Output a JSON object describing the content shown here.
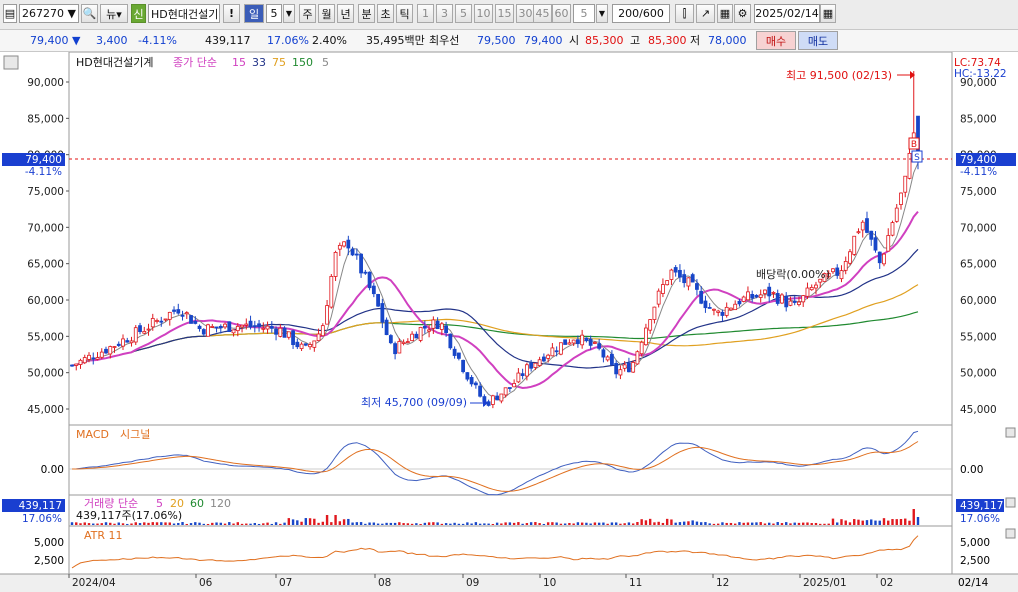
{
  "toolbar": {
    "code": "267270",
    "new_badge": "신",
    "stock_name": "HD현대건설기",
    "warn": "!",
    "period_num": "5",
    "periods": [
      "일",
      "주",
      "월",
      "년",
      "분",
      "초",
      "틱"
    ],
    "period_selected": "일",
    "intervals": [
      "1",
      "3",
      "5",
      "10",
      "15",
      "30",
      "45",
      "60"
    ],
    "interval_value": "5",
    "count": "200/600",
    "date": "2025/02/14"
  },
  "quote": {
    "price": "79,400",
    "change": "3,400",
    "change_pct": "-4.11%",
    "volume": "439,117",
    "turnover": "17.06%",
    "ratio": "2.40%",
    "amount": "35,495백만",
    "best_label": "최우선",
    "best_ask": "79,500",
    "best_bid": "79,400",
    "open_label": "시",
    "open": "85,300",
    "high_label": "고",
    "high": "85,300",
    "low_label": "저",
    "low": "78,000",
    "buy_label": "매수",
    "sell_label": "매도"
  },
  "legend": {
    "name": "HD현대건설기계",
    "ma_label": "종가 단순",
    "ma_periods": [
      "15",
      "33",
      "75",
      "150",
      "5"
    ],
    "macd": "MACD",
    "macd_signal": "시그널",
    "vol_label": "거래량 단순",
    "vol_periods": [
      "5",
      "20",
      "60",
      "120"
    ],
    "vol_value": "439,117주(17.06%)",
    "atr": "ATR 11"
  },
  "annotations": {
    "high": "최고 91,500 (02/13)",
    "low": "최저 45,700 (09/09)",
    "dividend": "배당락(0.00%)",
    "lc": "LC:73.74",
    "hc": "HC:-13.22",
    "cur_price": "79,400",
    "cur_pct": "-4.11%",
    "vol_price": "439,117",
    "vol_pct": "17.06%"
  },
  "axis": {
    "price_ticks": [
      "90,000",
      "85,000",
      "80,000",
      "75,000",
      "70,000",
      "65,000",
      "60,000",
      "55,000",
      "50,000",
      "45,000"
    ],
    "macd_ticks": [
      "0.00"
    ],
    "atr_ticks": [
      "5,000",
      "2,500"
    ],
    "x_labels": [
      "2024/04",
      "06",
      "07",
      "08",
      "09",
      "10",
      "11",
      "12",
      "2025/01",
      "02"
    ],
    "x_right": "02/14"
  },
  "colors": {
    "up": "#e0181e",
    "down": "#1846c8",
    "ma5": "#888888",
    "ma15": "#d040c0",
    "ma33": "#223388",
    "ma75": "#e0a020",
    "ma150": "#208a30",
    "macd": "#4060c0",
    "signal": "#e07020",
    "atr": "#e07020"
  },
  "chart_data": {
    "type": "candlestick",
    "title": "HD현대건설기계",
    "x_range": [
      "2024/04",
      "2025/02/14"
    ],
    "price_range": [
      44000,
      95000
    ],
    "price_anchors": [
      {
        "x": "2024/04",
        "close": 51000
      },
      {
        "x": "2024/05",
        "close": 56500
      },
      {
        "x": "2024/06",
        "close": 57000
      },
      {
        "x": "2024/07",
        "close": 55000
      },
      {
        "x": "2024/07-late",
        "close": 66000
      },
      {
        "x": "2024/08",
        "close": 56000
      },
      {
        "x": "2024/09/09",
        "close": 45700
      },
      {
        "x": "2024/10",
        "close": 54000
      },
      {
        "x": "2024/11",
        "close": 60000
      },
      {
        "x": "2024/12",
        "close": 61000
      },
      {
        "x": "2025/01",
        "close": 64000
      },
      {
        "x": "2025/02/13",
        "high": 91500
      },
      {
        "x": "2025/02/14",
        "open": 85300,
        "high": 85300,
        "low": 78000,
        "close": 79400
      }
    ],
    "macd_range": [
      -3000,
      3000
    ],
    "atr_range": [
      0,
      6500
    ],
    "atr_peaks": [
      {
        "x": "2024/07",
        "value": 5400
      },
      {
        "x": "2025/02",
        "value": 5600
      }
    ]
  }
}
